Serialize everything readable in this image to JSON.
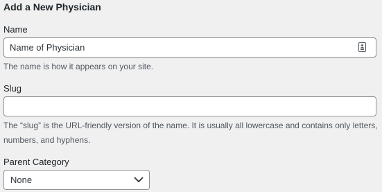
{
  "form": {
    "heading": "Add a New Physician",
    "name": {
      "label": "Name",
      "placeholder": "Name of Physician",
      "value": "",
      "icon": "contact-card-icon",
      "description": "The name is how it appears on your site."
    },
    "slug": {
      "label": "Slug",
      "value": "",
      "description": "The “slug” is the URL-friendly version of the name. It is usually all lowercase and contains only letters, numbers, and hyphens."
    },
    "parent": {
      "label": "Parent Category",
      "selected": "None"
    }
  }
}
